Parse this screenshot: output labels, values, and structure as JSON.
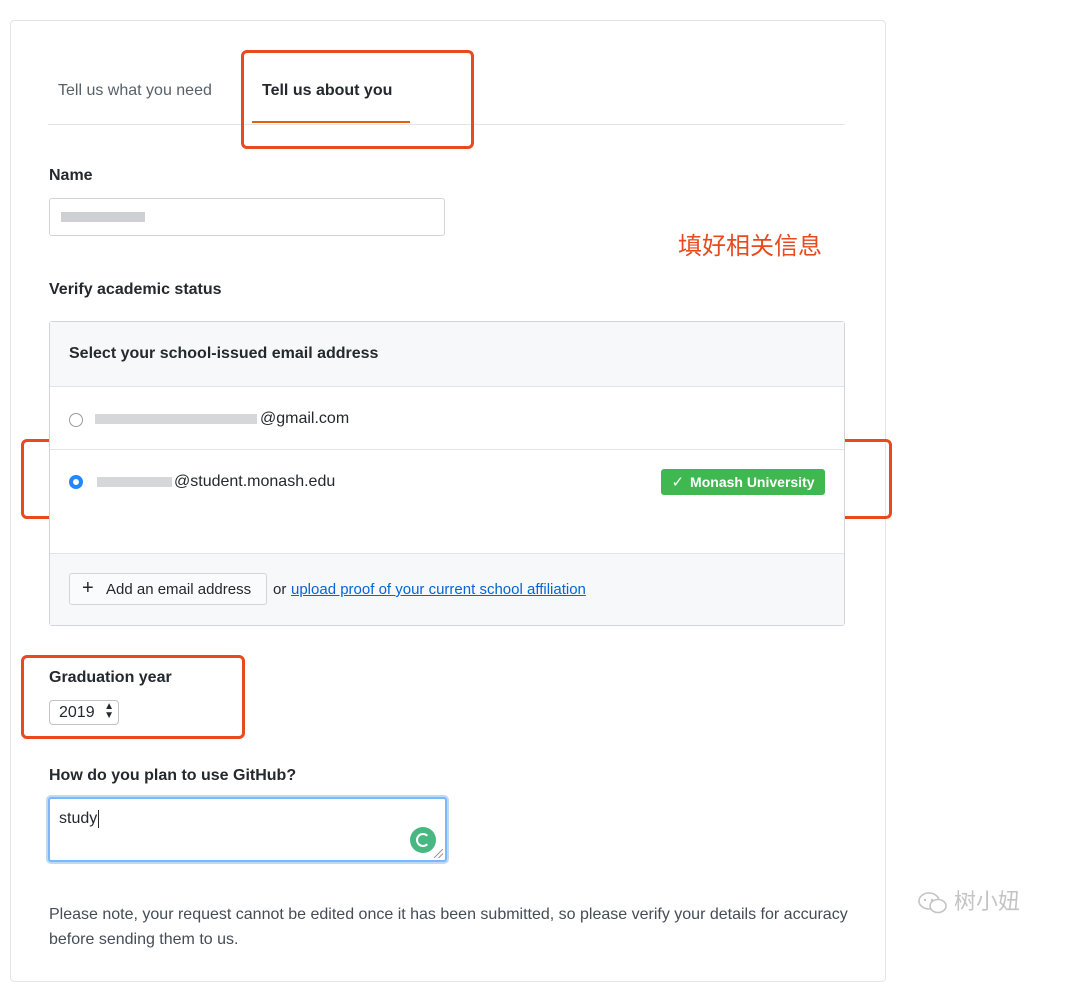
{
  "tabs": [
    {
      "label": "Tell us what you need",
      "active": false
    },
    {
      "label": "Tell us about you",
      "active": true
    }
  ],
  "annotation": {
    "note": "填好相关信息",
    "color": "#e8491d"
  },
  "form": {
    "name_label": "Name",
    "verify_label": "Verify academic status",
    "email_box": {
      "header": "Select your school-issued email address",
      "emails": [
        {
          "address_suffix": "@gmail.com",
          "selected": false
        },
        {
          "address_suffix": "@student.monash.edu",
          "selected": true,
          "badge": "Monash University"
        }
      ],
      "add_button": "Add an email address",
      "or": "or",
      "upload_link": "upload proof of your current school affiliation"
    },
    "graduation_label": "Graduation year",
    "graduation_year": "2019",
    "plan_label": "How do you plan to use GitHub?",
    "plan_value": "study",
    "note": "Please note, your request cannot be edited once it has been submitted, so please verify your details for accuracy before sending them to us."
  },
  "watermark": "树小妞",
  "colors": {
    "accent": "#e36209",
    "badge_green": "#3fb94f",
    "link": "#0366d6",
    "radio_selected": "#2188ff"
  }
}
